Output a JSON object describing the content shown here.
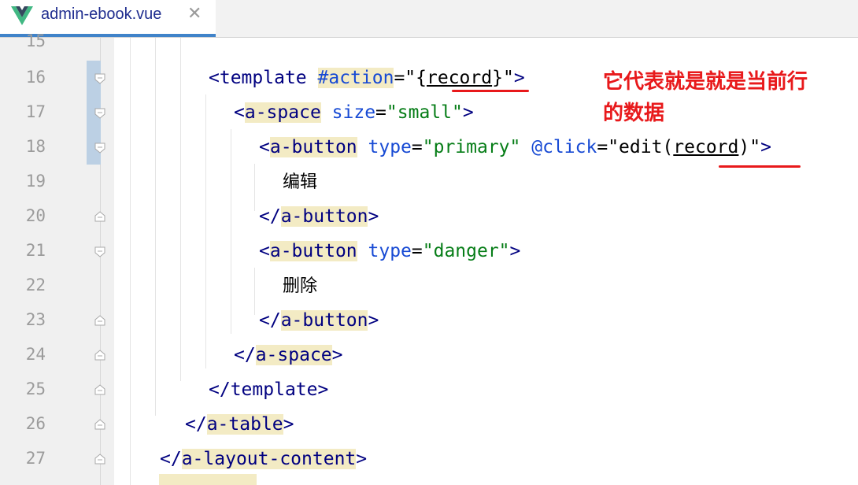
{
  "tab": {
    "filename": "admin-ebook.vue",
    "close_glyph": "✕",
    "icon": "vue-logo-icon"
  },
  "colors": {
    "tag": "#000080",
    "attribute": "#174ad4",
    "string": "#067d17",
    "tag_highlight": "#f3ebc4",
    "annotation": "#e8191b",
    "tab_accent": "#4083c9"
  },
  "line_numbers": [
    "15",
    "16",
    "17",
    "18",
    "19",
    "20",
    "21",
    "22",
    "23",
    "24",
    "25",
    "26",
    "27"
  ],
  "code": {
    "l16": {
      "open": "<",
      "tag": "template",
      "sp": " ",
      "attr": "#action",
      "eq": "=",
      "q1": "\"",
      "brace1": "{",
      "var": "record",
      "brace2": "}",
      "q2": "\"",
      "close": ">"
    },
    "l17": {
      "open": "<",
      "tag": "a-space",
      "sp": " ",
      "attr": "size",
      "eq": "=",
      "val": "\"small\"",
      "close": ">"
    },
    "l18": {
      "open": "<",
      "tag": "a-button",
      "sp": " ",
      "attr1": "type",
      "eq1": "=",
      "val1": "\"primary\"",
      "sp2": " ",
      "attr2": "@click",
      "eq2": "=",
      "q1": "\"",
      "fn": "edit(",
      "var": "record",
      "paren": ")",
      "q2": "\"",
      "close": ">"
    },
    "l19": {
      "text": "编辑"
    },
    "l20": {
      "open": "</",
      "tag": "a-button",
      "close": ">"
    },
    "l21": {
      "open": "<",
      "tag": "a-button",
      "sp": " ",
      "attr": "type",
      "eq": "=",
      "val": "\"danger\"",
      "close": ">"
    },
    "l22": {
      "text": "删除"
    },
    "l23": {
      "open": "</",
      "tag": "a-button",
      "close": ">"
    },
    "l24": {
      "open": "</",
      "tag": "a-space",
      "close": ">"
    },
    "l25": {
      "open": "</",
      "tag": "template",
      "close": ">"
    },
    "l26": {
      "open": "</",
      "tag": "a-table",
      "close": ">"
    },
    "l27": {
      "open": "</",
      "tag": "a-layout-content",
      "close": ">"
    }
  },
  "annotation": {
    "line1": "它代表就是就是当前行",
    "line2": "的数据"
  }
}
